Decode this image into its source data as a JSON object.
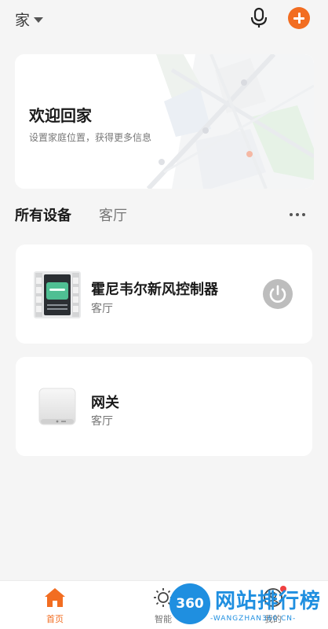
{
  "header": {
    "home_label": "家",
    "mic_icon": "microphone-icon",
    "add_icon": "plus-icon",
    "accent_color": "#f26d21"
  },
  "welcome": {
    "title": "欢迎回家",
    "subtitle": "设置家庭位置，获得更多信息",
    "background": "map-illustration"
  },
  "tabs": [
    {
      "label": "所有设备",
      "active": true
    },
    {
      "label": "客厅",
      "active": false
    }
  ],
  "more_icon": "more-horizontal-icon",
  "devices": [
    {
      "name": "霍尼韦尔新风控制器",
      "room": "客厅",
      "icon": "air-controller-panel",
      "power": "off",
      "has_power_button": true
    },
    {
      "name": "网关",
      "room": "客厅",
      "icon": "gateway-box",
      "has_power_button": false
    }
  ],
  "bottom_nav": [
    {
      "label": "首页",
      "icon": "home-icon",
      "active": true
    },
    {
      "label": "智能",
      "icon": "sun-icon",
      "active": false
    },
    {
      "label": "我的",
      "icon": "user-icon",
      "active": false,
      "badge": true
    }
  ],
  "watermark": {
    "logo": "360",
    "text": "网站排行榜",
    "url": "-WANGZHAN360.CN-"
  }
}
